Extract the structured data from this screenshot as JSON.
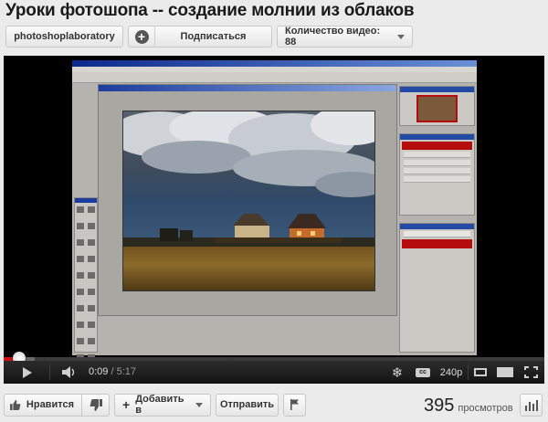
{
  "video": {
    "title": "Уроки фотошопа -- создание молнии из облаков",
    "current_time": "0:09",
    "duration": "5:17",
    "quality": "240p",
    "progress": 0.028
  },
  "channel": {
    "name": "photoshoplaboratory",
    "subscribe_label": "Подписаться",
    "video_count_label": "Количество видео: 88"
  },
  "actions": {
    "like_label": "Нравится",
    "add_label": "Добавить в",
    "share_label": "Отправить"
  },
  "stats": {
    "views": "395",
    "views_label": "просмотров"
  },
  "icons": {
    "subscribe": "plus-icon",
    "like": "thumbs-up-icon",
    "dislike": "thumbs-down-icon",
    "add": "plus-icon",
    "flag": "flag-icon",
    "stats": "bar-chart-icon",
    "play": "play-icon",
    "volume": "speaker-icon",
    "settings": "snowflake-icon",
    "captions": "cc-icon",
    "small_player": "small-player-icon",
    "large_player": "large-player-icon",
    "fullscreen": "fullscreen-icon"
  },
  "colors": {
    "progress_played": "#d40f0f",
    "photoshop_accent": "#b50d0d",
    "title_text": "#1a1a1a"
  }
}
